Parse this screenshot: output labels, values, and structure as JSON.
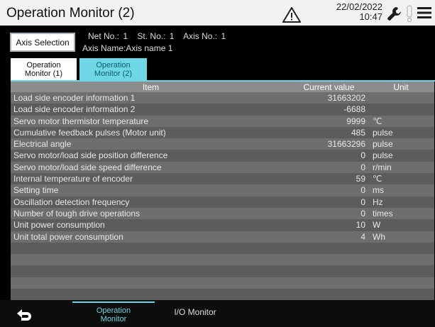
{
  "header": {
    "title": "Operation Monitor (2)",
    "date": "22/02/2022",
    "time": "10:47",
    "icons": [
      "warning-icon",
      "wrench-icon",
      "alert-icon",
      "menu-icon"
    ]
  },
  "axis": {
    "button_label": "Axis Selection",
    "net_label": "Net No.:",
    "net_value": "1",
    "station_label": "St. No.:",
    "station_value": "1",
    "axis_label": "Axis No.:",
    "axis_value": "1",
    "axis_name_label": "Axis Name:",
    "axis_name_value": "Axis name 1"
  },
  "tabs": [
    {
      "line1": "Operation",
      "line2": "Monitor (1)"
    },
    {
      "line1": "Operation",
      "line2": "Monitor (2)"
    }
  ],
  "table": {
    "headers": {
      "item": "Item",
      "value": "Current value",
      "unit": "Unit"
    },
    "rows": [
      {
        "item": "Load side encoder information 1",
        "value": "31663202",
        "unit": ""
      },
      {
        "item": "Load side encoder information 2",
        "value": "-6688",
        "unit": ""
      },
      {
        "item": "Servo motor thermistor temperature",
        "value": "9999",
        "unit": "℃"
      },
      {
        "item": "Cumulative feedback pulses (Motor unit)",
        "value": "485",
        "unit": "pulse"
      },
      {
        "item": "Electrical angle",
        "value": "31663296",
        "unit": "pulse"
      },
      {
        "item": "Servo motor/load side position difference",
        "value": "0",
        "unit": "pulse"
      },
      {
        "item": "Servo motor/load side speed difference",
        "value": "0",
        "unit": "r/min"
      },
      {
        "item": "Internal temperature of encoder",
        "value": "59",
        "unit": "℃"
      },
      {
        "item": "Setting time",
        "value": "0",
        "unit": "ms"
      },
      {
        "item": "Oscillation detection frequency",
        "value": "0",
        "unit": "Hz"
      },
      {
        "item": "Number of tough drive operations",
        "value": "0",
        "unit": "times"
      },
      {
        "item": "Unit power consumption",
        "value": "10",
        "unit": "W"
      },
      {
        "item": "Unit total power consumption",
        "value": "4",
        "unit": "Wh"
      },
      {
        "item": "",
        "value": "",
        "unit": ""
      },
      {
        "item": "",
        "value": "",
        "unit": ""
      },
      {
        "item": "",
        "value": "",
        "unit": ""
      },
      {
        "item": "",
        "value": "",
        "unit": ""
      },
      {
        "item": "",
        "value": "",
        "unit": ""
      }
    ]
  },
  "bottom": {
    "back_icon": "back-arrow-icon",
    "tab1_line1": "Operation",
    "tab1_line2": "Monitor",
    "tab2": "I/O Monitor"
  },
  "colors": {
    "accent": "#6fd6e6",
    "header_bg": "#f2f2f2",
    "row_odd": "#6e6e6e",
    "row_even": "#5c5c5c"
  }
}
